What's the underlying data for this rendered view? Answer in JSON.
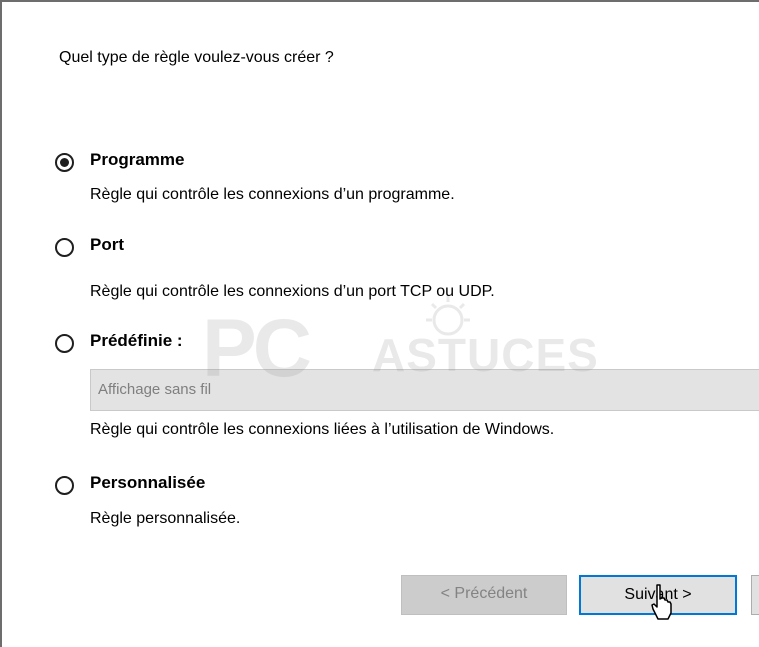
{
  "dialog": {
    "question": "Quel type de règle voulez-vous créer ?"
  },
  "options": [
    {
      "title": "Programme",
      "description": "Règle qui contrôle les connexions d’un programme.",
      "selected": true
    },
    {
      "title": "Port",
      "description": "Règle qui contrôle les connexions d’un port TCP ou UDP.",
      "selected": false
    },
    {
      "title": "Prédéfinie :",
      "field_value": "Affichage sans fil",
      "description": "Règle qui contrôle les connexions liées à l’utilisation de Windows.",
      "selected": false
    },
    {
      "title": "Personnalisée",
      "description": "Règle personnalisée.",
      "selected": false
    }
  ],
  "buttons": {
    "previous": "< Précédent",
    "next": "Suivant >"
  },
  "watermark": {
    "logo_text_1": "PC",
    "logo_text_2": "ASTUCES"
  },
  "colors": {
    "accent": "#0078d7",
    "disabled_text": "#838383"
  },
  "icons": {
    "cursor": "hand-pointer-cursor-icon"
  }
}
